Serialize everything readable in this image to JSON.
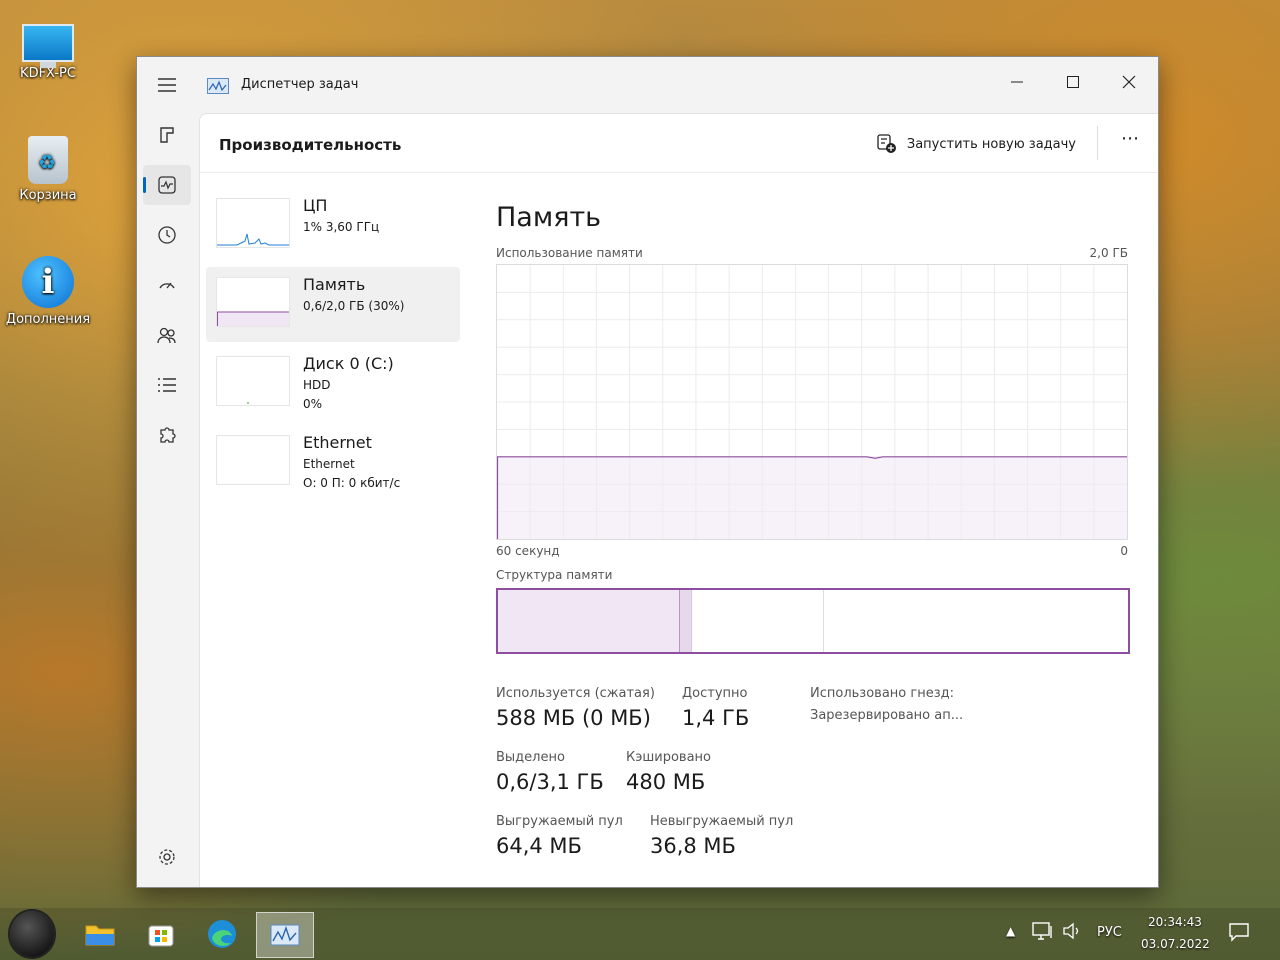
{
  "desktop": {
    "icons": [
      {
        "label": "KDFX-PC"
      },
      {
        "label": "Корзина"
      },
      {
        "label": "Дополнения"
      }
    ]
  },
  "window": {
    "title": "Диспетчер задач",
    "page_title": "Производительность",
    "run_task_label": "Запустить новую задачу",
    "more_label": "⋯"
  },
  "perf_list": [
    {
      "name": "ЦП",
      "line1": "1% 3,60 ГГц",
      "line2": ""
    },
    {
      "name": "Память",
      "line1": "0,6/2,0 ГБ (30%)",
      "line2": ""
    },
    {
      "name": "Диск 0 (C:)",
      "line1": "HDD",
      "line2": "0%"
    },
    {
      "name": "Ethernet",
      "line1": "Ethernet",
      "line2": "О: 0 П: 0 кбит/с"
    }
  ],
  "memory": {
    "title": "Память",
    "usage_label": "Использование памяти",
    "usage_max": "2,0 ГБ",
    "time_left": "60 секунд",
    "time_right": "0",
    "usage_fraction": 0.3,
    "structure_label": "Структура памяти",
    "structure": {
      "in_use": 0.29,
      "modified": 0.02,
      "standby": 0.21,
      "free": 0.48
    },
    "stats": {
      "in_use_label": "Используется (сжатая)",
      "in_use_value": "588 МБ (0 МБ)",
      "available_label": "Доступно",
      "available_value": "1,4 ГБ",
      "committed_label": "Выделено",
      "committed_value": "0,6/3,1 ГБ",
      "cached_label": "Кэшировано",
      "cached_value": "480 МБ",
      "paged_label": "Выгружаемый пул",
      "paged_value": "64,4 МБ",
      "nonpaged_label": "Невыгружаемый пул",
      "nonpaged_value": "36,8 МБ",
      "slots_label": "Использовано гнезд:",
      "reserved_label": "Зарезервировано ап..."
    }
  },
  "colors": {
    "memory_accent": "#8e4ea0",
    "memory_fill": "#f1e7f4",
    "cpu_accent": "#1f7fd6"
  },
  "taskbar": {
    "language": "РУС",
    "time": "20:34:43",
    "date": "03.07.2022"
  }
}
